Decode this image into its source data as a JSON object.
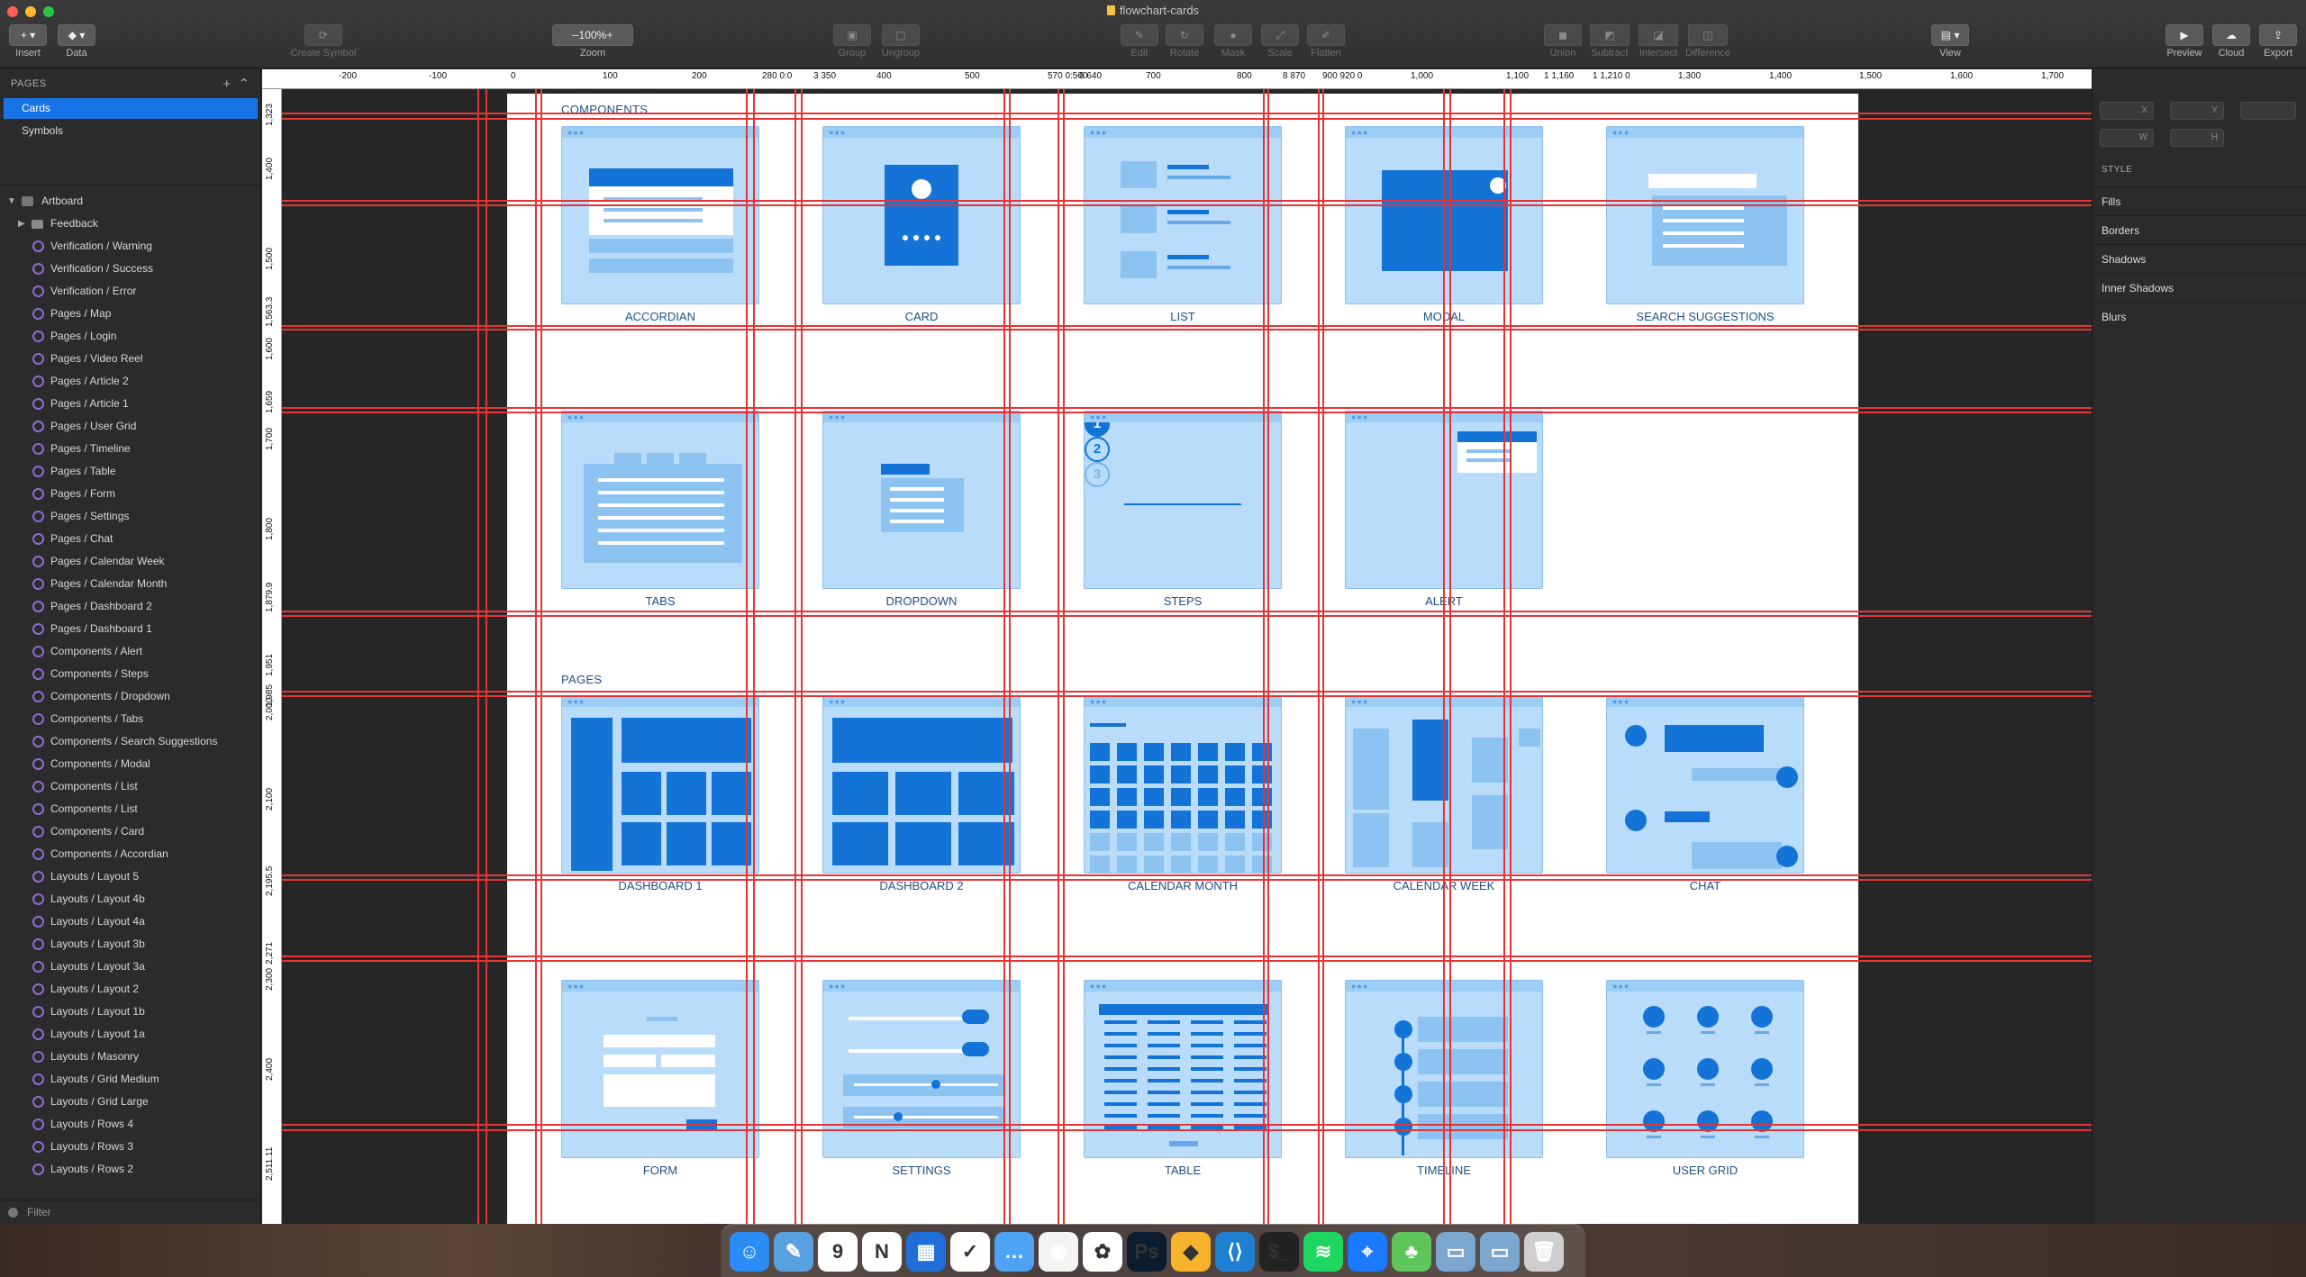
{
  "window": {
    "title": "flowchart-cards"
  },
  "toolbar": {
    "insert": "Insert",
    "data": "Data",
    "create_symbol": "Create Symbol",
    "zoom_label": "Zoom",
    "zoom_value": "100%",
    "zoom_minus": "–",
    "zoom_plus": "+",
    "group": "Group",
    "ungroup": "Ungroup",
    "edit": "Edit",
    "rotate": "Rotate",
    "mask": "Mask",
    "scale": "Scale",
    "flatten": "Flatten",
    "union": "Union",
    "subtract": "Subtract",
    "intersect": "Intersect",
    "difference": "Difference",
    "view": "View",
    "preview": "Preview",
    "cloud": "Cloud",
    "export": "Export"
  },
  "sidebar": {
    "pages_header": "PAGES",
    "pages": [
      {
        "label": "Cards",
        "selected": true
      },
      {
        "label": "Symbols",
        "selected": false
      }
    ],
    "artboard": "Artboard",
    "folder": "Feedback",
    "layers": [
      "Verification / Warning",
      "Verification / Success",
      "Verification / Error",
      "Pages / Map",
      "Pages / Login",
      "Pages / Video Reel",
      "Pages / Article 2",
      "Pages / Article 1",
      "Pages / User Grid",
      "Pages / Timeline",
      "Pages / Table",
      "Pages / Form",
      "Pages / Settings",
      "Pages / Chat",
      "Pages / Calendar Week",
      "Pages / Calendar Month",
      "Pages / Dashboard 2",
      "Pages / Dashboard 1",
      "Components / Alert",
      "Components / Steps",
      "Components / Dropdown",
      "Components / Tabs",
      "Components / Search Suggestions",
      "Components / Modal",
      "Components / List",
      "Components / List",
      "Components / Card",
      "Components / Accordian",
      "Layouts / Layout 5",
      "Layouts / Layout 4b",
      "Layouts / Layout 4a",
      "Layouts / Layout 3b",
      "Layouts / Layout 3a",
      "Layouts / Layout 2",
      "Layouts / Layout 1b",
      "Layouts / Layout 1a",
      "Layouts / Masonry",
      "Layouts / Grid Medium",
      "Layouts / Grid Large",
      "Layouts / Rows 4",
      "Layouts / Rows 3",
      "Layouts / Rows 2"
    ],
    "filter": "Filter"
  },
  "ruler_top": [
    "-200",
    "-100",
    "0",
    "100",
    "200",
    "280 0:0",
    "3 350",
    "400",
    "500",
    "570 0:500",
    "6 640",
    "700",
    "800",
    "8 870",
    "900 920 0",
    "1,000",
    "1,100",
    "1 1,160",
    "1 1,210 0",
    "1,300",
    "1,400",
    "1,500",
    "1,600",
    "1,700"
  ],
  "ruler_left": [
    "1,323",
    "1,400",
    "1,500",
    "1,563.3",
    "1,600",
    "1,659",
    "1,700",
    "1,800",
    "1,879.9",
    "1,951",
    "1,985",
    "2,000",
    "2,100",
    "2,195.5",
    "2,271",
    "2,300",
    "2,400",
    "2,511.11"
  ],
  "canvas": {
    "components_label": "COMPONENTS",
    "pages_label": "PAGES",
    "cards": [
      "ACCORDIAN",
      "CARD",
      "LIST",
      "MODAL",
      "SEARCH SUGGESTIONS",
      "TABS",
      "DROPDOWN",
      "STEPS",
      "ALERT",
      "DASHBOARD 1",
      "DASHBOARD 2",
      "CALENDAR MONTH",
      "CALENDAR WEEK",
      "CHAT",
      "FORM",
      "SETTINGS",
      "TABLE",
      "TIMELINE",
      "USER GRID"
    ],
    "steps": [
      "1",
      "2",
      "3"
    ]
  },
  "inspector": {
    "x": "X",
    "y": "Y",
    "w": "W",
    "h": "H",
    "style": "STYLE",
    "fills": "Fills",
    "borders": "Borders",
    "shadows": "Shadows",
    "inner_shadows": "Inner Shadows",
    "blurs": "Blurs"
  },
  "colors": {
    "accent": "#1874e6",
    "guide": "#e63434",
    "card_fill": "#b9dcfa",
    "card_blue": "#1373d6"
  },
  "dock": [
    "finder-icon",
    "preview-icon",
    "calendar-icon",
    "notion-icon",
    "trello-icon",
    "tasks-icon",
    "chat-bubble-icon",
    "chrome-icon",
    "photos-icon",
    "photoshop-icon",
    "sketch-icon",
    "vscode-icon",
    "terminal-icon",
    "spotify-icon",
    "maps-icon",
    "cactus-icon",
    "folder-icon",
    "folder-icon",
    "trash-icon"
  ]
}
